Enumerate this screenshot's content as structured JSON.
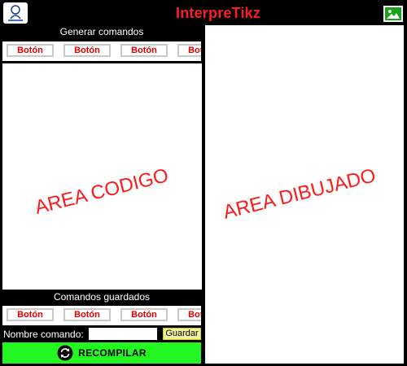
{
  "header": {
    "title": "InterpreTikz",
    "logo_icon": "app-logo-icon",
    "image_icon": "image-icon"
  },
  "generate_section": {
    "title": "Generar comandos",
    "buttons": [
      "Botón",
      "Botón",
      "Botón",
      "Botón"
    ]
  },
  "code_area": {
    "placeholder_label": "AREA CODIGO"
  },
  "saved_section": {
    "title": "Comandos guardados",
    "buttons": [
      "Botón",
      "Botón",
      "Botón",
      "Botón"
    ]
  },
  "command_name": {
    "label": "Nombre comando:",
    "value": "",
    "save_label": "Guardar"
  },
  "recompile": {
    "label": "RECOMPILAR",
    "icon": "refresh-icon"
  },
  "drawing_area": {
    "placeholder_label": "AREA DIBUJADO"
  },
  "colors": {
    "background": "#000000",
    "title": "#ff1e1e",
    "button_text": "#e10000",
    "recompile_bg": "#22f722",
    "save_bg": "#f0f0a0",
    "image_btn_bg": "#1aa31a"
  }
}
